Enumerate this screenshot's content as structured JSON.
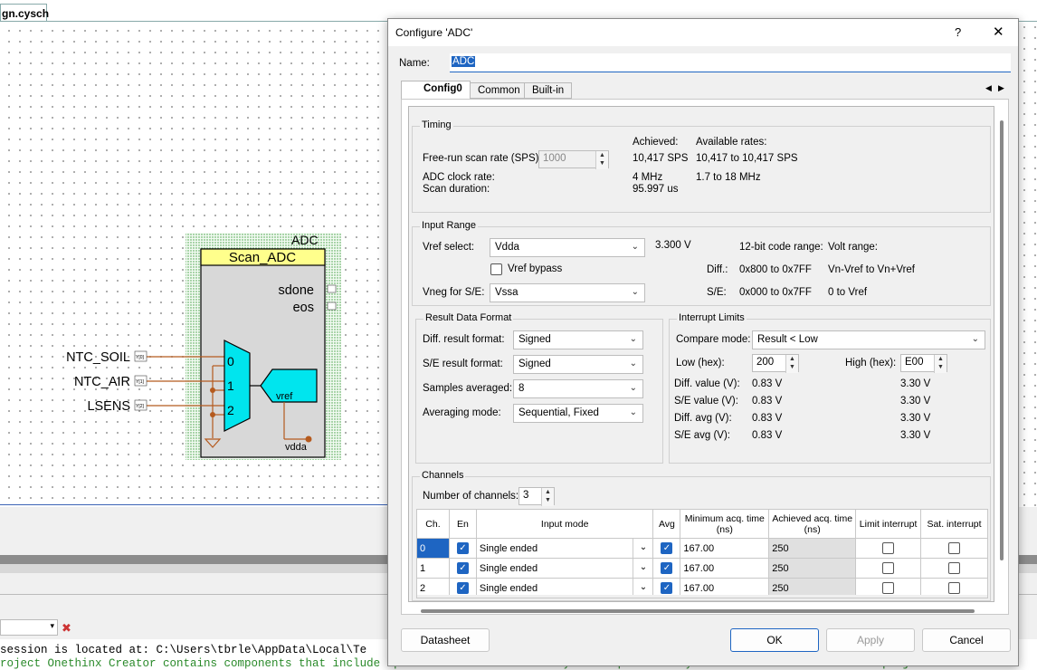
{
  "schematic": {
    "tab_label": "gn.cysch",
    "component": {
      "instance": "ADC",
      "title": "Scan_ADC",
      "out_ports": [
        "sdone",
        "eos"
      ],
      "mux_inputs": [
        "0",
        "1",
        "2"
      ],
      "vref_label": "vref",
      "vdda_label": "vdda",
      "nets": [
        "NTC_SOIL",
        "NTC_AIR",
        "LSENS"
      ],
      "net_port_tags": [
        "Y[0]",
        "Y[1]",
        "Y[2]"
      ]
    }
  },
  "status": {
    "line1": "session is located at: C:\\Users\\tbrle\\AppData\\Local\\Te",
    "line2": "roject Onethinx Creator contains components that include special code that runs on your computer. Do you trust the source of this project and w"
  },
  "dialog": {
    "title": "Configure 'ADC'",
    "help": "?",
    "close": "✕",
    "name_label": "Name:",
    "name_value": "ADC",
    "tabs": [
      "Config0",
      "Common",
      "Built-in"
    ],
    "tab_scroll": [
      "◀",
      "▶"
    ],
    "timing": {
      "title": "Timing",
      "achieved_label": "Achieved:",
      "available_label": "Available rates:",
      "scan_rate_label": "Free-run scan rate (SPS):",
      "scan_rate_value": "1000",
      "scan_rate_achieved": "10,417 SPS",
      "scan_rate_available": "10,417 to 10,417 SPS",
      "clock_label": "ADC clock rate:",
      "clock_achieved": "4 MHz",
      "clock_available": "1.7 to 18 MHz",
      "duration_label": "Scan duration:",
      "duration_achieved": "95.997 us"
    },
    "input_range": {
      "title": "Input Range",
      "vref_label": "Vref select:",
      "vref_value": "Vdda",
      "vref_volts": "3.300 V",
      "bypass_label": "Vref bypass",
      "vneg_label": "Vneg for S/E:",
      "vneg_value": "Vssa",
      "code_range_label": "12-bit code range:",
      "volt_range_label": "Volt range:",
      "diff_label": "Diff.:",
      "diff_code": "0x800 to 0x7FF",
      "diff_volt": "Vn-Vref to Vn+Vref",
      "se_label": "S/E:",
      "se_code": "0x000 to 0x7FF",
      "se_volt": "0 to Vref"
    },
    "result_format": {
      "title": "Result Data Format",
      "diff_label": "Diff. result format:",
      "diff_value": "Signed",
      "se_label": "S/E result format:",
      "se_value": "Signed",
      "samples_label": "Samples averaged:",
      "samples_value": "8",
      "avg_mode_label": "Averaging mode:",
      "avg_mode_value": "Sequential, Fixed"
    },
    "interrupt_limits": {
      "title": "Interrupt Limits",
      "compare_label": "Compare mode:",
      "compare_value": "Result < Low",
      "low_label": "Low (hex):",
      "low_value": "200",
      "high_label": "High (hex):",
      "high_value": "E00",
      "rows": [
        {
          "label": "Diff. value (V):",
          "low": "0.83 V",
          "high": "3.30 V"
        },
        {
          "label": "S/E value (V):",
          "low": "0.83 V",
          "high": "3.30 V"
        },
        {
          "label": "Diff. avg (V):",
          "low": "0.83 V",
          "high": "3.30 V"
        },
        {
          "label": "S/E avg (V):",
          "low": "0.83 V",
          "high": "3.30 V"
        }
      ]
    },
    "channels": {
      "title": "Channels",
      "count_label": "Number of channels:",
      "count_value": "3",
      "headers": [
        "Ch.",
        "En",
        "Input mode",
        "Avg",
        "Minimum acq. time (ns)",
        "Achieved acq. time (ns)",
        "Limit interrupt",
        "Sat. interrupt"
      ],
      "rows": [
        {
          "ch": "0",
          "mode": "Single ended",
          "min": "167.00",
          "achieved": "250"
        },
        {
          "ch": "1",
          "mode": "Single ended",
          "min": "167.00",
          "achieved": "250"
        },
        {
          "ch": "2",
          "mode": "Single ended",
          "min": "167.00",
          "achieved": "250"
        }
      ]
    },
    "buttons": {
      "datasheet": "Datasheet",
      "ok": "OK",
      "apply": "Apply",
      "cancel": "Cancel"
    }
  }
}
